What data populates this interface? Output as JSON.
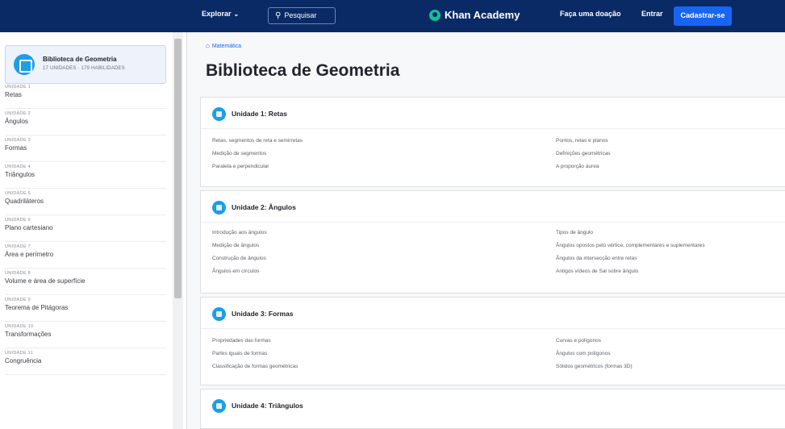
{
  "nav": {
    "explore": "Explorar",
    "search": "Pesquisar",
    "brand": "Khan Academy",
    "donate": "Faça uma doação",
    "login": "Entrar",
    "signup": "Cadastrar-se"
  },
  "sidebar": {
    "library_title": "Biblioteca de Geometria",
    "library_sub": "17 UNIDADES · 179 HABILIDADES",
    "units": [
      {
        "num": "UNIDADE 1",
        "name": "Retas"
      },
      {
        "num": "UNIDADE 2",
        "name": "Ângulos"
      },
      {
        "num": "UNIDADE 3",
        "name": "Formas"
      },
      {
        "num": "UNIDADE 4",
        "name": "Triângulos"
      },
      {
        "num": "UNIDADE 5",
        "name": "Quadriláteros"
      },
      {
        "num": "UNIDADE 6",
        "name": "Plano cartesiano"
      },
      {
        "num": "UNIDADE 7",
        "name": "Área e perímetro"
      },
      {
        "num": "UNIDADE 8",
        "name": "Volume e área de superfície"
      },
      {
        "num": "UNIDADE 9",
        "name": "Teorema de Pitágoras"
      },
      {
        "num": "UNIDADE 10",
        "name": "Transformações"
      },
      {
        "num": "UNIDADE 11",
        "name": "Congruência"
      }
    ]
  },
  "main": {
    "breadcrumb": "Matemática",
    "title": "Biblioteca de Geometria",
    "cards": [
      {
        "title": "Unidade 1: Retas",
        "left": [
          "Retas, segmentos de reta e semirretas",
          "Medição de segmentos",
          "Paralela e perpendicular"
        ],
        "right": [
          "Pontos, retas e planos",
          "Definições geométricas",
          "A proporção áurea"
        ]
      },
      {
        "title": "Unidade 2: Ângulos",
        "left": [
          "Introdução aos ângulos",
          "Medição de ângulos",
          "Construção de ângulos",
          "Ângulos em círculos"
        ],
        "right": [
          "Tipos de ângulo",
          "Ângulos opostos pelo vértice, complementares e suplementares",
          "Ângulos da intersecção entre retas",
          "Antigos vídeos de Sal sobre ângulo"
        ]
      },
      {
        "title": "Unidade 3: Formas",
        "left": [
          "Propriedades das formas",
          "Partes iguais de formas",
          "Classificação de formas geométricas"
        ],
        "right": [
          "Curvas e polígonos",
          "Ângulos com polígonos",
          "Sólidos geométricos (formas 3D)"
        ]
      },
      {
        "title": "Unidade 4: Triângulos",
        "left": [],
        "right": []
      }
    ]
  }
}
